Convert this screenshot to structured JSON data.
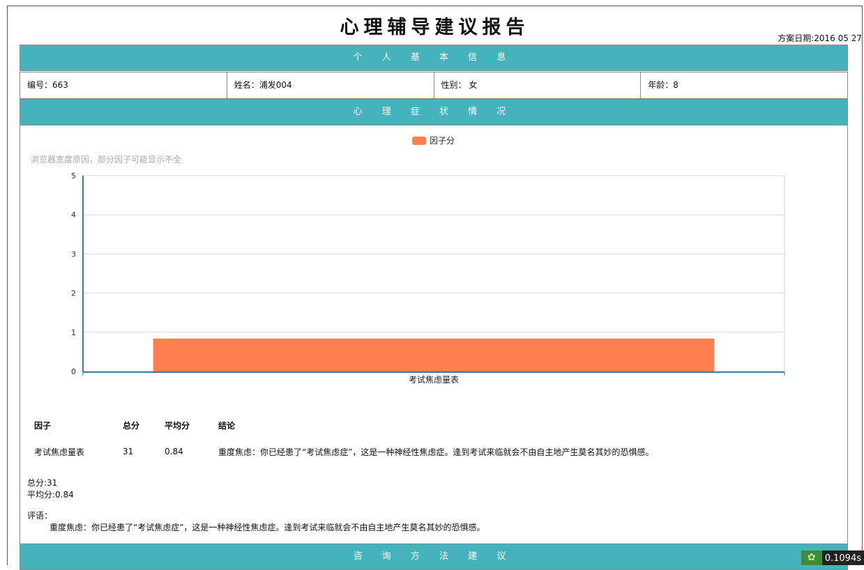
{
  "report": {
    "title": "心理辅导建议报告",
    "plan_date": "方案日期:2016 05 27"
  },
  "sections": {
    "basic_info": "个 人 基 本 信 息",
    "symptoms": "心 理 症 状 情 况",
    "advice": "咨 询 方 法 建 议"
  },
  "basic_info": {
    "id": "编号：663",
    "name": "姓名：浦发004",
    "gender": "性别： 女",
    "age": "年龄：8"
  },
  "chart_note": "浏览器宽度原因，部分因子可能显示不全",
  "chart_data": {
    "type": "bar",
    "categories": [
      "考试焦虑量表"
    ],
    "series": [
      {
        "name": "因子分",
        "values": [
          0.84
        ]
      }
    ],
    "ylim": [
      0,
      5
    ],
    "yticks": [
      0,
      1,
      2,
      3,
      4,
      5
    ],
    "grid": true,
    "legend": "top-center",
    "bar_color": "#ff7f50",
    "axis_color": "#3a7ca5"
  },
  "table": {
    "headers": [
      "因子",
      "总分",
      "平均分",
      "结论"
    ],
    "rows": [
      [
        "考试焦虑量表",
        "31",
        "0.84",
        "重度焦虑：你已经患了“考试焦虑症”，这是一种神经性焦虑症。逢到考试来临就会不由自主地产生莫名其妙的恐惧感。"
      ]
    ]
  },
  "summary": {
    "total": "总分:31",
    "average": "平均分:0.84"
  },
  "comment": {
    "label": "评语：",
    "text": "重度焦虑：你已经患了“考试焦虑症”，这是一种神经性焦虑症。逢到考试来临就会不由自主地产生莫名其妙的恐惧感。"
  },
  "timer": {
    "icon": "leaf-icon",
    "value": "0.1094s"
  },
  "colors": {
    "header_bg": "#45b3bb",
    "bar": "#ff7f50"
  }
}
